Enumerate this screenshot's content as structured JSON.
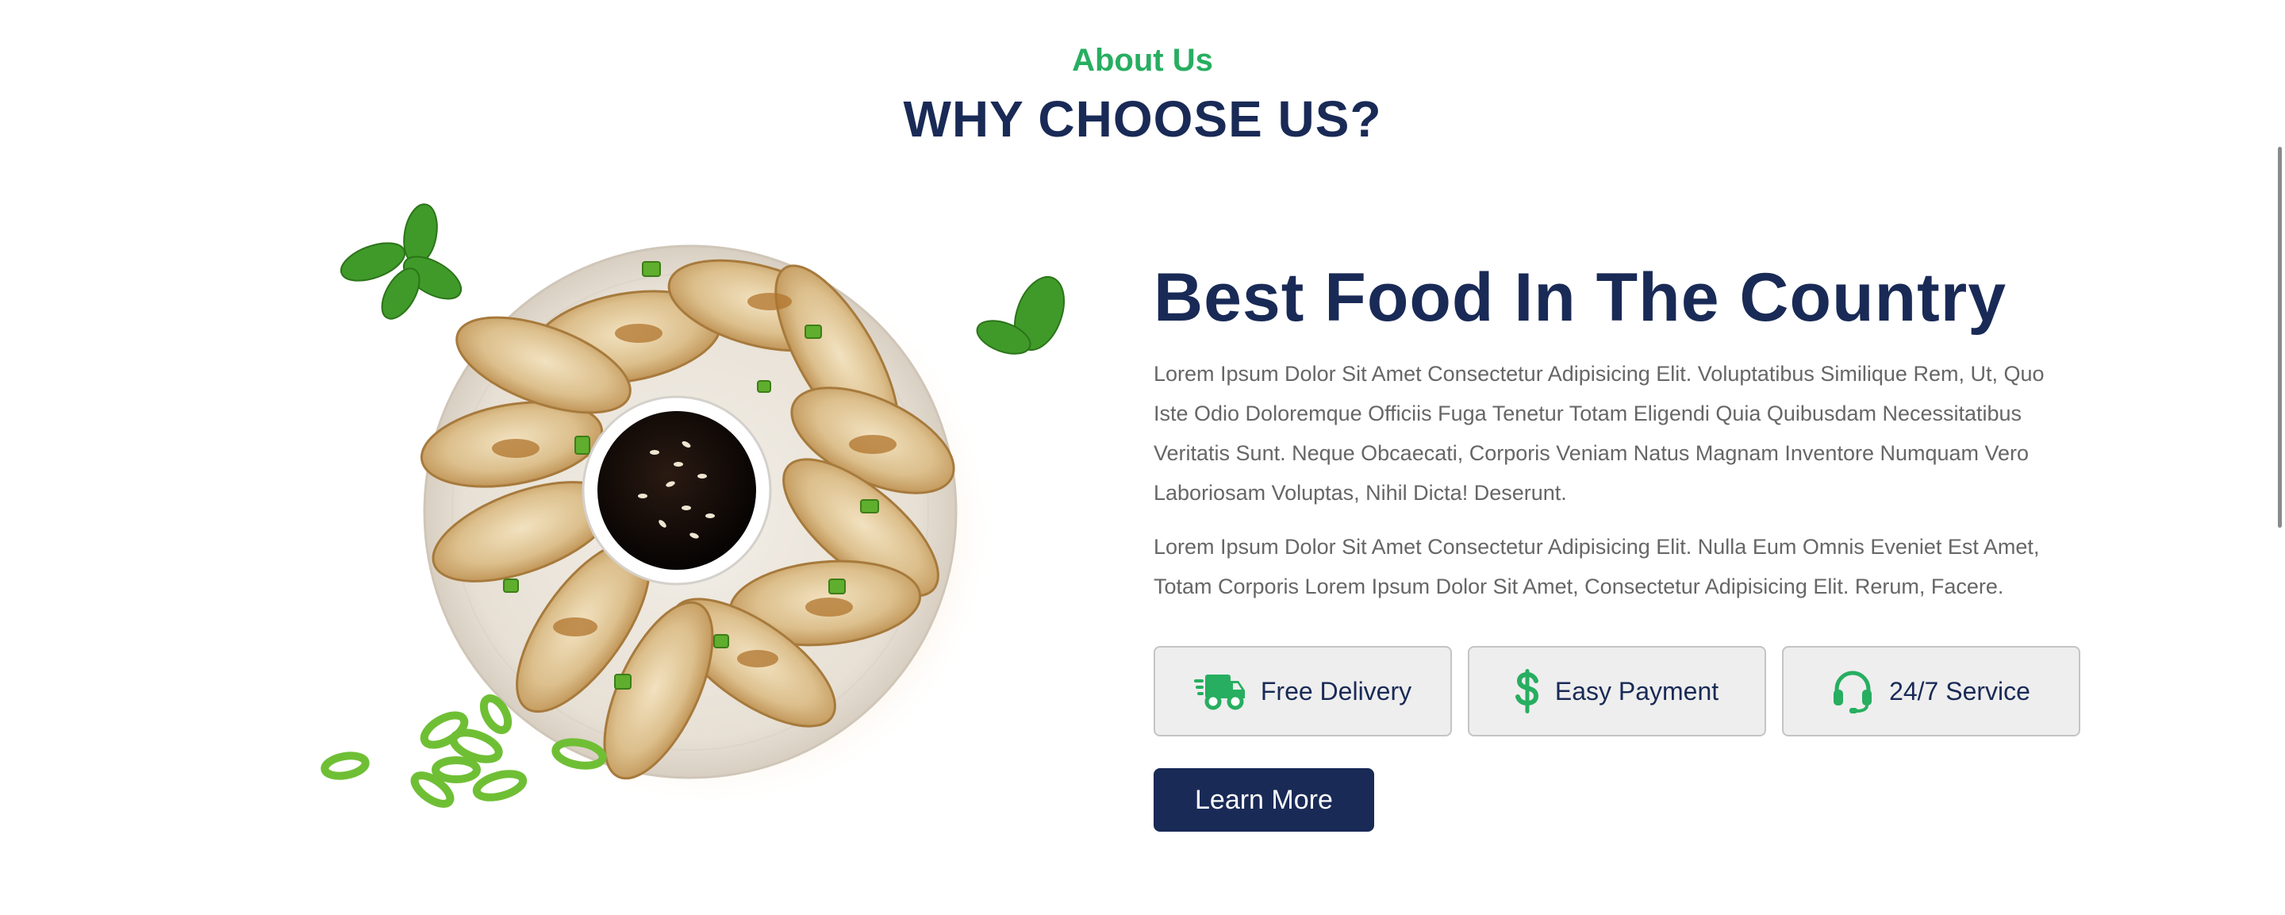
{
  "section": {
    "subtitle": "About Us",
    "title": "WHY CHOOSE US?"
  },
  "content": {
    "title": "Best Food In The Country",
    "paragraph_1": "Lorem Ipsum Dolor Sit Amet Consectetur Adipisicing Elit. Voluptatibus Similique Rem, Ut, Quo Iste Odio Doloremque Officiis Fuga Tenetur Totam Eligendi Quia Quibusdam Necessitatibus Veritatis Sunt. Neque Obcaecati, Corporis Veniam Natus Magnam Inventore Numquam Vero Laboriosam Voluptas, Nihil Dicta! Deserunt.",
    "paragraph_2": "Lorem Ipsum Dolor Sit Amet Consectetur Adipisicing Elit. Nulla Eum Omnis Eveniet Est Amet, Totam Corporis Lorem Ipsum Dolor Sit Amet, Consectetur Adipisicing Elit. Rerum, Facere."
  },
  "features": [
    {
      "label": "Free Delivery",
      "icon": "shipping-fast-icon"
    },
    {
      "label": "Easy Payment",
      "icon": "dollar-sign-icon"
    },
    {
      "label": "24/7 Service",
      "icon": "headset-icon"
    }
  ],
  "cta": {
    "label": "Learn More"
  },
  "colors": {
    "accent_green": "#27ae60",
    "navy": "#192a56",
    "body_text": "#666666",
    "feature_bg": "#eeeeee"
  },
  "image": {
    "subject": "plate-of-dumplings-with-soy-sauce"
  }
}
